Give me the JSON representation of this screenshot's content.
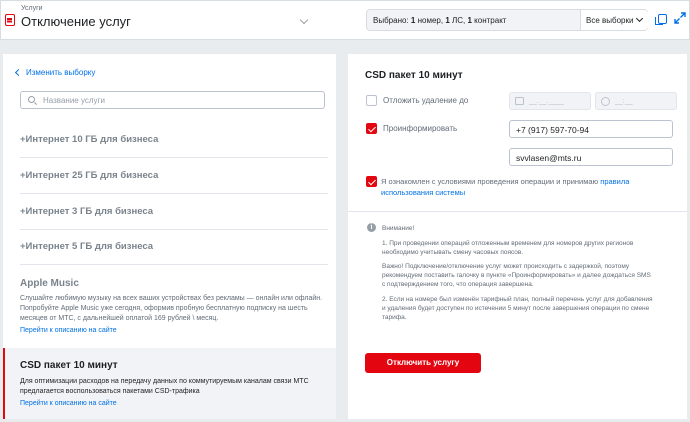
{
  "header": {
    "breadcrumb": "Услуги",
    "title": "Отключение услуг",
    "selection_summary_prefix": "Выбрано:",
    "selection_summary_numbers": "1",
    "selection_summary_numbers_label": "номер,",
    "selection_summary_accounts": "1",
    "selection_summary_accounts_label": "ЛС,",
    "selection_summary_contracts": "1",
    "selection_summary_contracts_label": "контракт",
    "selection_dropdown_value": "Все выборки"
  },
  "left": {
    "back_label": "Изменить выборку",
    "search_placeholder": "Название услуги",
    "services": [
      "+Интернет 10 ГБ для бизнеса",
      "+Интернет 25 ГБ для бизнеса",
      "+Интернет 3 ГБ для бизнеса",
      "+Интернет 5 ГБ для бизнеса"
    ],
    "apple": {
      "title": "Apple Music",
      "desc_1": "Слушайте любимую музыку на всех ваших устройствах без рекламы — онлайн или офлайн.",
      "desc_2": "Попробуйте Apple Music уже сегодня, оформив пробную бесплатную подписку на шесть",
      "desc_3": "месяцев от МТС, с дальнейшей оплатой 169 рублей \\ месяц.",
      "link": "Перейти к описанию на сайте"
    },
    "selected": {
      "title": "CSD пакет 10 минут",
      "desc_1": "Для оптимизации расходов на передачу данных по коммутируемым каналам связи МТС",
      "desc_2": "предлагается воспользоваться пакетами CSD-трафика",
      "link": "Перейти к описанию на сайте"
    }
  },
  "right": {
    "title": "CSD пакет 10 минут",
    "postpone_label": "Отложить удаление до",
    "date_placeholder": "__.__.____",
    "time_placeholder": "__:__",
    "notify_label": "Проинформировать",
    "phone": "+7 (917) 597-70-94",
    "email": "svvlasen@mts.ru",
    "agree_text": "Я ознакомлен с условиями проведения операции и принимаю",
    "agree_link_1": "правила",
    "agree_link_2": "использования системы",
    "notice_title": "Внимание!",
    "notice_1a": "1. При проведении операций отложенным временем для номеров других регионов",
    "notice_1b": "необходимо учитывать смену часовых поясов.",
    "notice_2a": "Важно! Подключение/отключение услуг может происходить с задержкой, поэтому",
    "notice_2b": "рекомендуем поставить галочку в пункте «Проинформировать» и далее дождаться SMS",
    "notice_2c": "с подтверждением того, что операция завершена.",
    "notice_3a": "2. Если на номере был изменён тарифный план, полный перечень услуг для добавления",
    "notice_3b": "и удаления будет доступен по истечении 5 минут после завершения операции по смене",
    "notice_3c": "тарифа.",
    "submit_label": "Отключить услугу"
  },
  "colors": {
    "accent": "#e30611",
    "link": "#0070e5"
  },
  "icons": [
    "document-icon",
    "chevron-down-icon",
    "copy-icon",
    "expand-icon",
    "chevron-left-icon",
    "search-icon",
    "calendar-icon",
    "clock-icon",
    "info-icon"
  ]
}
